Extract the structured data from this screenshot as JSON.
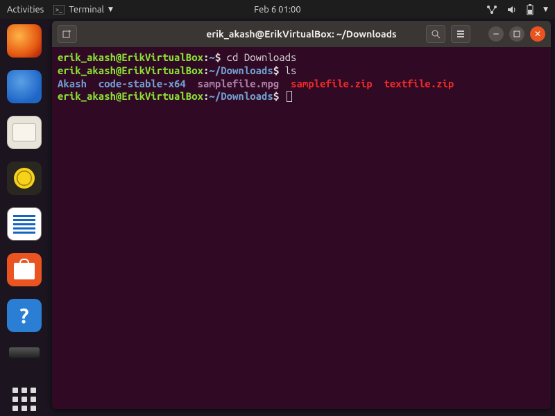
{
  "topbar": {
    "activities": "Activities",
    "app_label": "Terminal",
    "datetime": "Feb 6  01:00"
  },
  "dock": {
    "items": [
      {
        "name": "firefox"
      },
      {
        "name": "thunderbird"
      },
      {
        "name": "files"
      },
      {
        "name": "rhythmbox"
      },
      {
        "name": "libreoffice-writer"
      },
      {
        "name": "ubuntu-software"
      },
      {
        "name": "help"
      },
      {
        "name": "external-drive"
      },
      {
        "name": "show-applications"
      }
    ]
  },
  "terminal": {
    "window_title": "erik_akash@ErikVirtualBox: ~/Downloads",
    "prompt_user_host": "erik_akash@ErikVirtualBox",
    "lines": [
      {
        "path": "~",
        "command": "cd Downloads"
      },
      {
        "path": "~/Downloads",
        "command": "ls"
      }
    ],
    "ls_output": {
      "dirs": [
        "Akash",
        "code-stable-x64"
      ],
      "magenta": [
        "samplefile.mpg"
      ],
      "red": [
        "samplefile.zip",
        "textfile.zip"
      ]
    },
    "current_path": "~/Downloads"
  }
}
